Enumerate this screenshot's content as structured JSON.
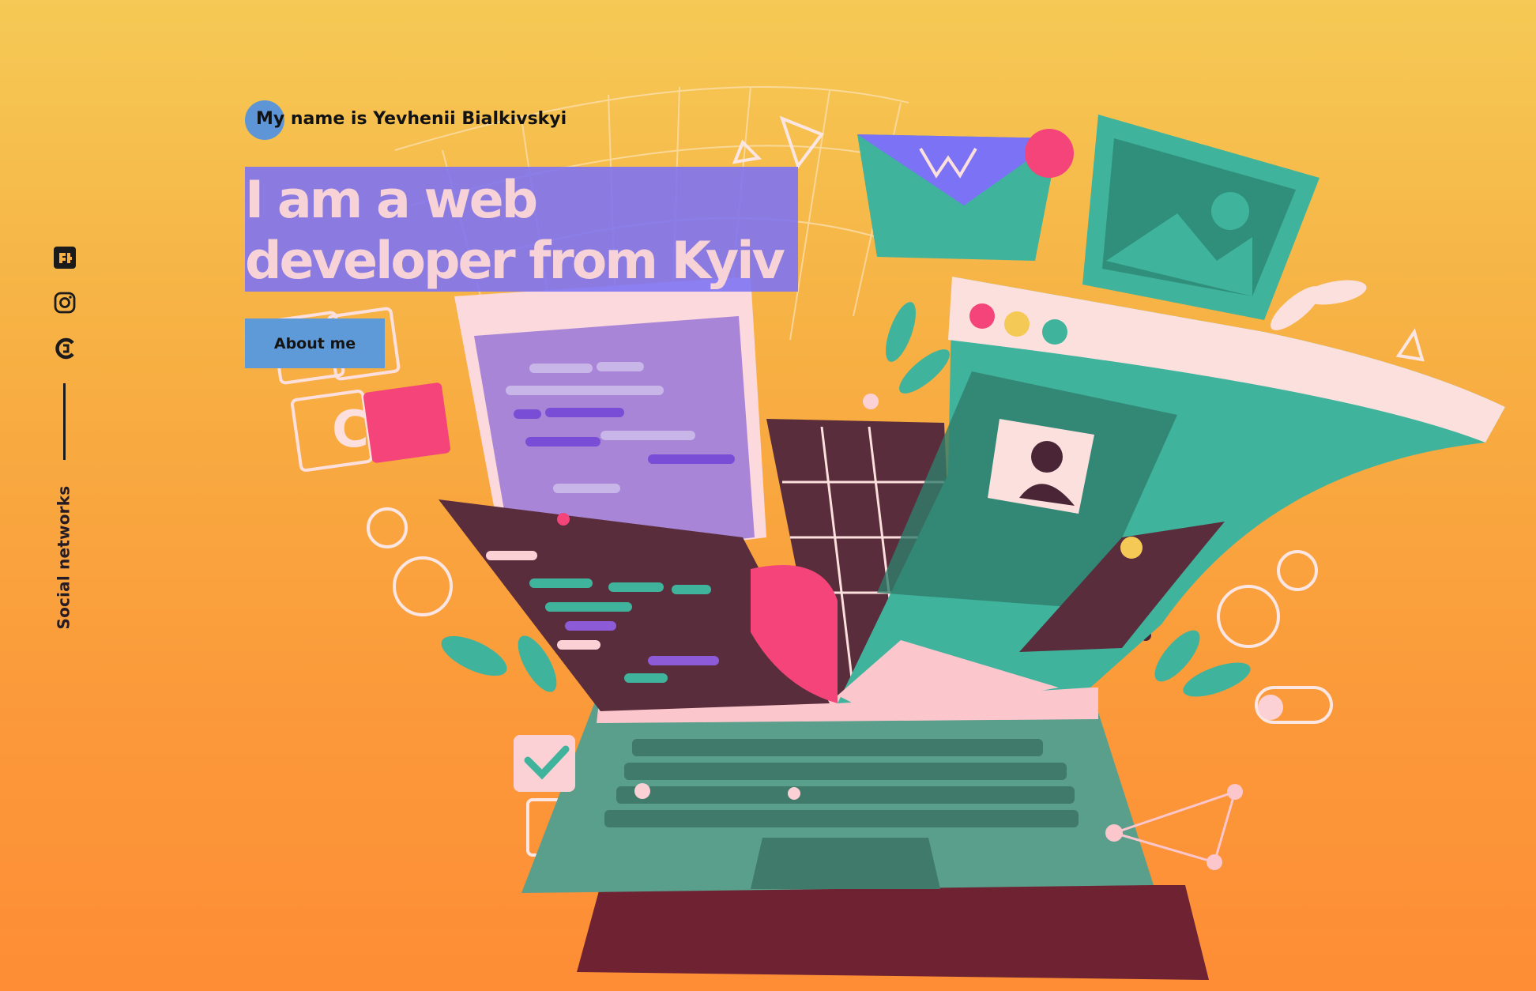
{
  "sidebar": {
    "links": [
      {
        "name": "freelancehunt",
        "icon": "freelancehunt-icon"
      },
      {
        "name": "instagram",
        "icon": "instagram-icon"
      },
      {
        "name": "codepen-like",
        "icon": "c-logo-icon"
      }
    ],
    "label": "Social networks"
  },
  "hero": {
    "intro": "My name is Yevhenii Bialkivskyi",
    "headline_line1": "I am a web",
    "headline_line2": "developer from Kyiv",
    "cta_label": "About me"
  },
  "colors": {
    "bg_top": "#f5c955",
    "bg_bottom": "#fe8d36",
    "accent_purple": "#7c72f5",
    "accent_blue": "#5f9ad8",
    "headline_text": "#f7d2d7",
    "teal": "#3fb39c",
    "dark_maroon": "#5a2d3c",
    "pink": "#f4447a"
  }
}
